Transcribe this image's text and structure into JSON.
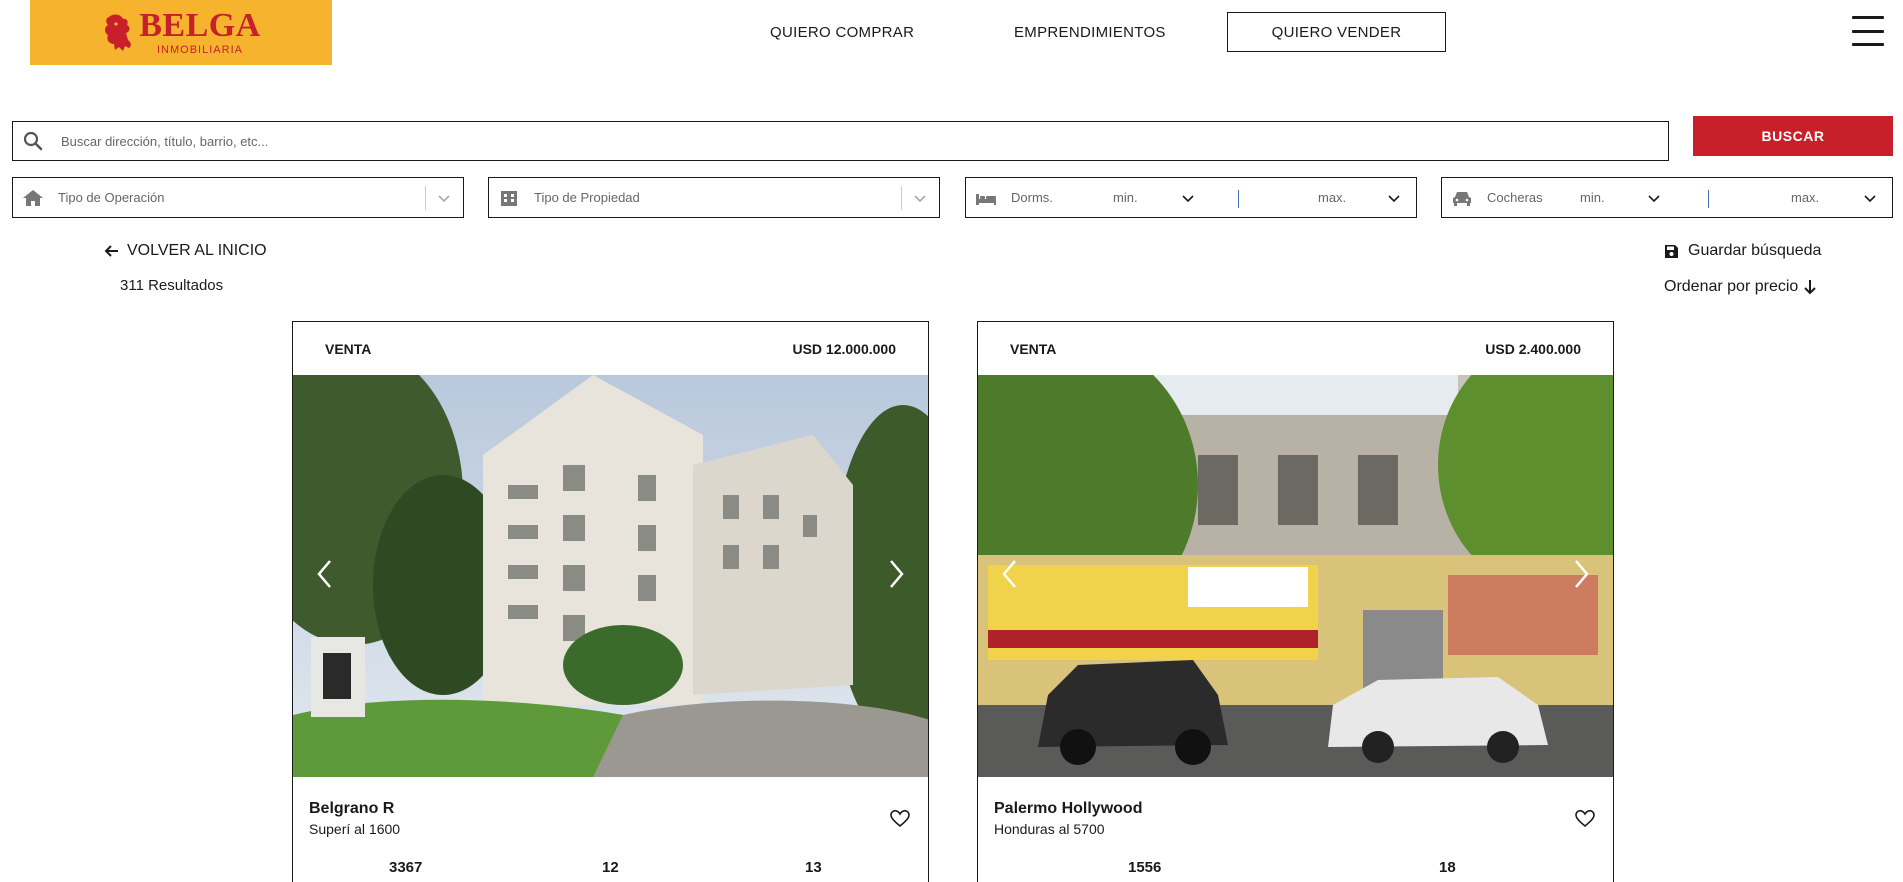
{
  "brand": {
    "name": "BELGA",
    "tagline": "INMOBILIARIA",
    "color_bg": "#f6b32d",
    "color_text": "#c8202b"
  },
  "nav": {
    "buy": "QUIERO COMPRAR",
    "developments": "EMPRENDIMIENTOS",
    "sell": "QUIERO VENDER"
  },
  "search": {
    "placeholder": "Buscar dirección, título, barrio, etc...",
    "button": "BUSCAR"
  },
  "filters": {
    "operation": "Tipo de Operación",
    "property": "Tipo de Propiedad",
    "bedrooms": {
      "label": "Dorms.",
      "min": "min.",
      "max": "max."
    },
    "garages": {
      "label": "Cocheras",
      "min": "min.",
      "max": "max."
    }
  },
  "results": {
    "back": "VOLVER AL INICIO",
    "count": "311 Resultados",
    "save": "Guardar búsqueda",
    "sort": "Ordenar por precio"
  },
  "listings": [
    {
      "operation": "VENTA",
      "price": "USD 12.000.000",
      "title": "Belgrano R",
      "address": "Superí al 1600",
      "stats": [
        "3367",
        "12",
        "13"
      ]
    },
    {
      "operation": "VENTA",
      "price": "USD 2.400.000",
      "title": "Palermo Hollywood",
      "address": "Honduras al 5700",
      "stats": [
        "1556",
        "18"
      ]
    }
  ],
  "colors": {
    "accent": "#c8202b",
    "text": "#1a1a1a",
    "muted": "#666666"
  }
}
